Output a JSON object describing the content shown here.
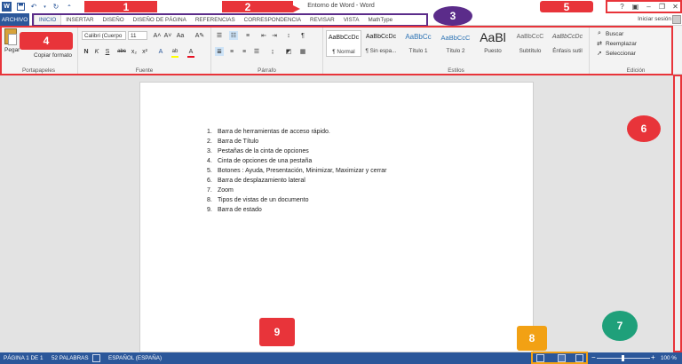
{
  "title_bar": {
    "doc_title": "Entorno de Word - Word"
  },
  "qat": {
    "icons": [
      "word-logo",
      "save-icon",
      "undo-icon",
      "redo-icon",
      "customize-icon"
    ],
    "logo_text": "W"
  },
  "tabs": {
    "archivo": "ARCHIVO",
    "items": [
      "INICIO",
      "INSERTAR",
      "DISEÑO",
      "DISEÑO DE PÁGINA",
      "REFERENCIAS",
      "CORRESPONDENCIA",
      "REVISAR",
      "VISTA",
      "MathType"
    ],
    "active_index": 0,
    "signin": "Iniciar sesión"
  },
  "window_controls": [
    "?",
    "▣",
    "–",
    "❐",
    "✕"
  ],
  "ribbon": {
    "portapapeles": {
      "label": "Portapapeles",
      "pegar": "Pegar",
      "copiar_formato": "Copiar formato"
    },
    "fuente": {
      "label": "Fuente",
      "font": "Calibri (Cuerpo",
      "size": "11",
      "buttons_row1": [
        "A˄",
        "A˅",
        "Aa",
        "A✎"
      ],
      "buttons_row2": [
        "N",
        "K",
        "S",
        "abc",
        "x₂",
        "x²",
        "A",
        "ab",
        "A"
      ]
    },
    "parrafo": {
      "label": "Párrafo"
    },
    "estilos": {
      "label": "Estilos",
      "items": [
        {
          "preview": "AaBbCcDc",
          "name": "¶ Normal"
        },
        {
          "preview": "AaBbCcDc",
          "name": "¶ Sin espa..."
        },
        {
          "preview": "AaBbCc",
          "name": "Título 1"
        },
        {
          "preview": "AaBbCcC",
          "name": "Título 2"
        },
        {
          "preview": "AaBl",
          "name": "Puesto"
        },
        {
          "preview": "AaBbCcC",
          "name": "Subtítulo"
        },
        {
          "preview": "AaBbCcDc",
          "name": "Énfasis sutil"
        }
      ]
    },
    "edicion": {
      "label": "Edición",
      "buscar": "Buscar",
      "reemplazar": "Reemplazar",
      "seleccionar": "Seleccionar"
    }
  },
  "document": {
    "items": [
      "Barra de herramientas de acceso rápido.",
      "Barra de Título",
      "Pestañas de la cinta de opciones",
      "Cinta de opciones de una pestaña",
      "Botones : Ayuda, Presentación, Minimizar, Maximizar y cerrar",
      "Barra de desplazamiento lateral",
      "Zoom",
      "Tipos de vistas de un documento",
      "Barra de estado"
    ]
  },
  "status_bar": {
    "page": "PÁGINA 1 DE 1",
    "words": "52 PALABRAS",
    "language": "ESPAÑOL (ESPAÑA)",
    "zoom": "100 %",
    "zoom_minus": "−",
    "zoom_plus": "+"
  },
  "annotations": {
    "labels": [
      "1",
      "2",
      "3",
      "4",
      "5",
      "6",
      "7",
      "8",
      "9"
    ],
    "colors": {
      "red": "#e8343a",
      "purple": "#5b2c8a",
      "green": "#1fa07a",
      "orange": "#f2a114"
    }
  },
  "colors": {
    "word_blue": "#2b579a"
  }
}
